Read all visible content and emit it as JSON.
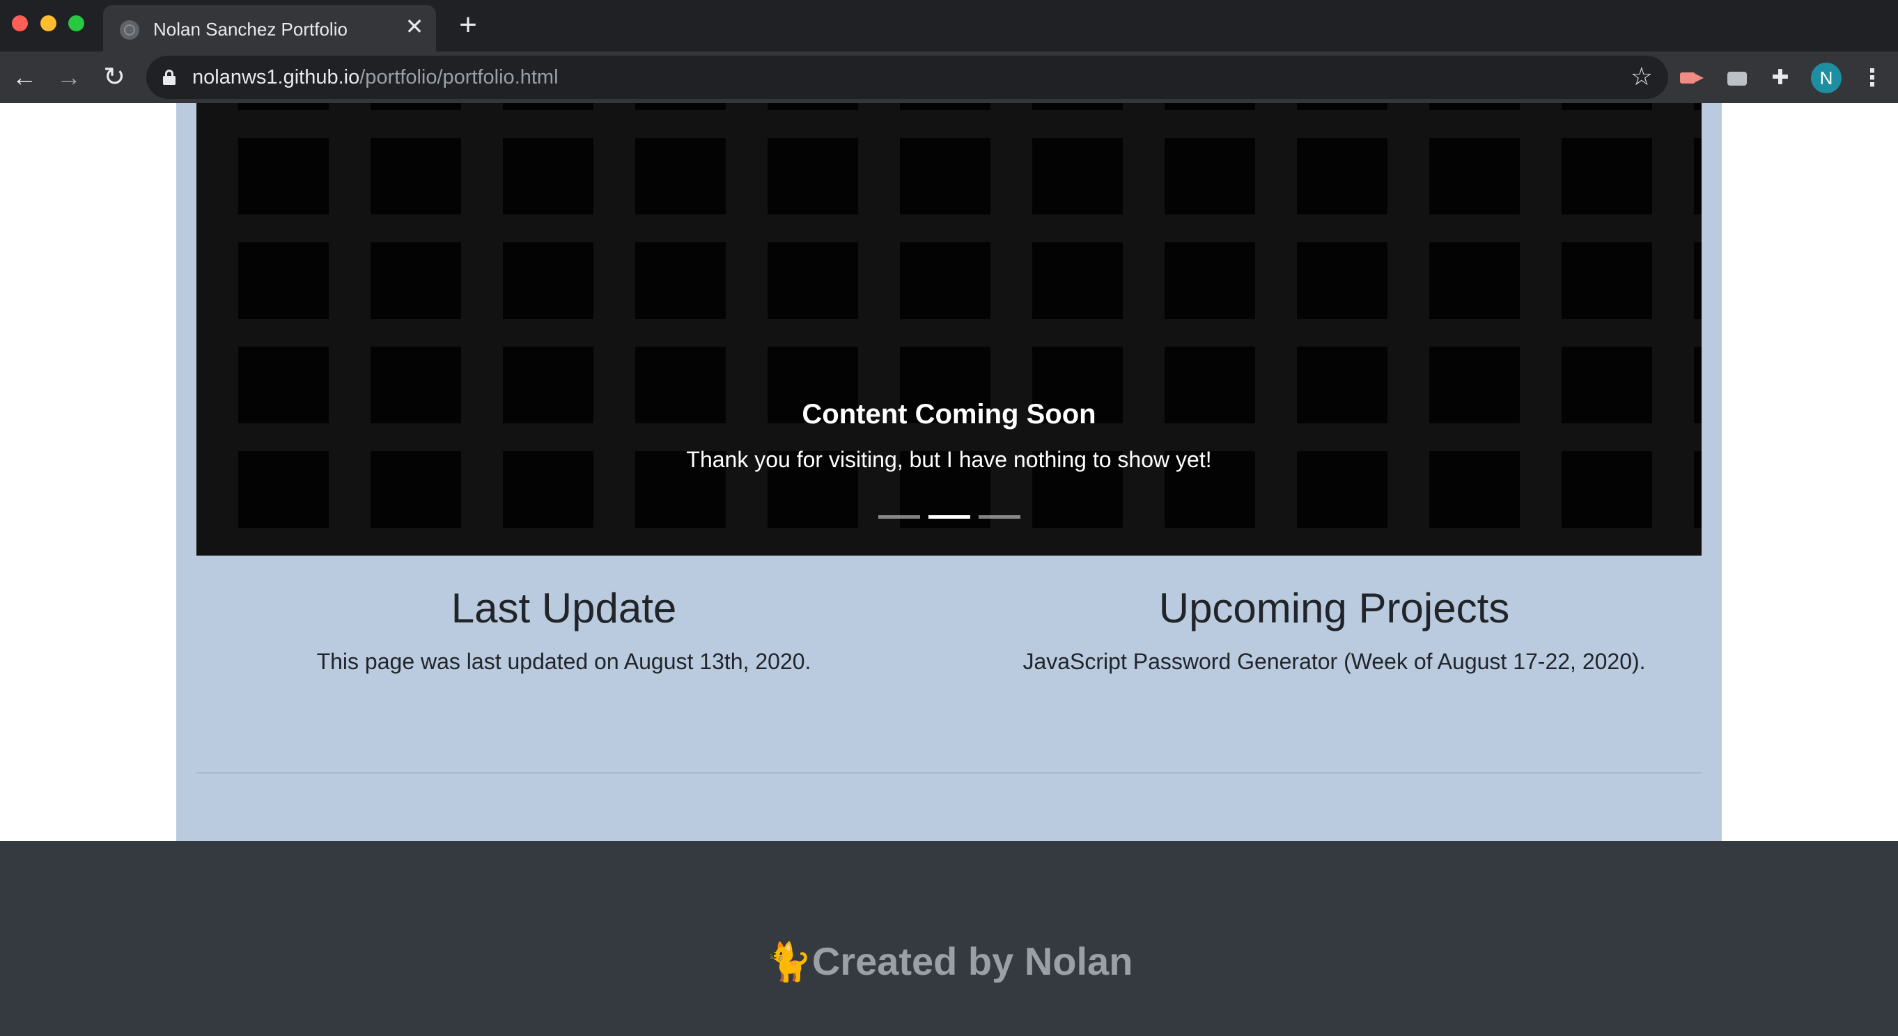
{
  "browser": {
    "tab_title": "Nolan Sanchez Portfolio",
    "tab_close": "✕",
    "new_tab": "+",
    "url_host": "nolanws1.github.io",
    "url_path": "/portfolio/portfolio.html",
    "profile_initial": "N",
    "icons": {
      "back": "←",
      "forward": "→",
      "reload": "↻",
      "star": "☆",
      "puzzle": "✚",
      "menu": "⋮"
    }
  },
  "carousel": {
    "caption_title": "Content Coming Soon",
    "caption_text": "Thank you for visiting, but I have nothing to show yet!",
    "slide_count": 3,
    "active_slide": 2
  },
  "last_update": {
    "heading": "Last Update",
    "text": "This page was last updated on August 13th, 2020."
  },
  "upcoming_projects": {
    "heading": "Upcoming Projects",
    "text": "JavaScript Password Generator (Week of August 17-22, 2020)."
  },
  "footer": {
    "icon": "🐈",
    "text": "Created by Nolan"
  },
  "colors": {
    "container_bg": "#bacbe0",
    "footer_bg": "#343a40",
    "carousel_bg": "#030303"
  }
}
